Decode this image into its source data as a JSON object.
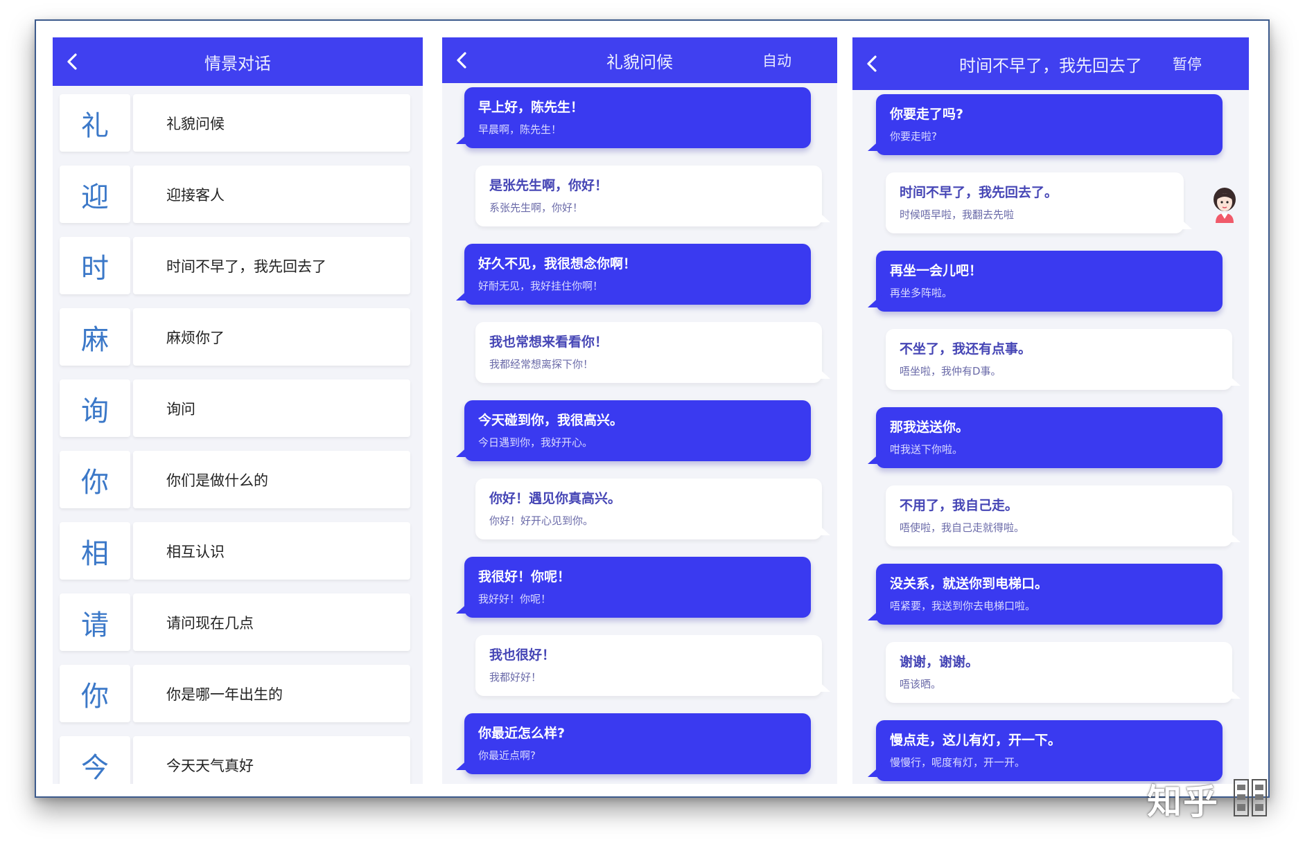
{
  "list_screen": {
    "title": "情景对话",
    "items": [
      {
        "char": "礼",
        "label": "礼貌问候"
      },
      {
        "char": "迎",
        "label": "迎接客人"
      },
      {
        "char": "时",
        "label": "时间不早了，我先回去了"
      },
      {
        "char": "麻",
        "label": "麻烦你了"
      },
      {
        "char": "询",
        "label": "询问"
      },
      {
        "char": "你",
        "label": "你们是做什么的"
      },
      {
        "char": "相",
        "label": "相互认识"
      },
      {
        "char": "请",
        "label": "请问现在几点"
      },
      {
        "char": "你",
        "label": "你是哪一年出生的"
      },
      {
        "char": "今",
        "label": "今天天气真好"
      }
    ]
  },
  "greeting_screen": {
    "title": "礼貌问候",
    "action": "自动",
    "messages": [
      {
        "side": "blue",
        "mandarin": "早上好，陈先生！",
        "cantonese": "早晨啊，陈先生！"
      },
      {
        "side": "white",
        "mandarin": "是张先生啊，你好！",
        "cantonese": "系张先生啊，你好！"
      },
      {
        "side": "blue",
        "mandarin": "好久不见，我很想念你啊！",
        "cantonese": "好耐无见，我好挂住你啊！"
      },
      {
        "side": "white",
        "mandarin": "我也常想来看看你！",
        "cantonese": "我都经常想离探下你！"
      },
      {
        "side": "blue",
        "mandarin": "今天碰到你，我很高兴。",
        "cantonese": "今日遇到你，我好开心。"
      },
      {
        "side": "white",
        "mandarin": "你好！遇见你真高兴。",
        "cantonese": "你好！好开心见到你。"
      },
      {
        "side": "blue",
        "mandarin": "我很好！你呢！",
        "cantonese": "我好好！你呢！"
      },
      {
        "side": "white",
        "mandarin": "我也很好！",
        "cantonese": "我都好好！"
      },
      {
        "side": "blue",
        "mandarin": "你最近怎么样?",
        "cantonese": "你最近点啊?"
      }
    ]
  },
  "leaving_screen": {
    "title": "时间不早了，我先回去了",
    "action": "暂停",
    "messages": [
      {
        "side": "blue",
        "mandarin": "你要走了吗?",
        "cantonese": "你要走啦?"
      },
      {
        "side": "white",
        "mandarin": "时间不早了，我先回去了。",
        "cantonese": "时候唔早啦，我翻去先啦"
      },
      {
        "side": "blue",
        "mandarin": "再坐一会儿吧！",
        "cantonese": "再坐多阵啦。"
      },
      {
        "side": "white",
        "mandarin": "不坐了，我还有点事。",
        "cantonese": "唔坐啦，我仲有D事。"
      },
      {
        "side": "blue",
        "mandarin": "那我送送你。",
        "cantonese": "咁我送下你啦。"
      },
      {
        "side": "white",
        "mandarin": "不用了，我自己走。",
        "cantonese": "唔使啦，我自己走就得啦。"
      },
      {
        "side": "blue",
        "mandarin": "没关系，就送你到电梯口。",
        "cantonese": "唔紧要，我送到你去电梯口啦。"
      },
      {
        "side": "white",
        "mandarin": "谢谢，谢谢。",
        "cantonese": "唔该晒。"
      },
      {
        "side": "blue",
        "mandarin": "慢点走，这儿有灯，开一下。",
        "cantonese": "慢慢行，呢度有灯，开一开。"
      }
    ]
  },
  "watermark": "知乎",
  "colors": {
    "header": "#4040f0",
    "bubble_blue": "#3a3af0",
    "char_blue": "#3b78c8",
    "background": "#f3f4f9"
  }
}
